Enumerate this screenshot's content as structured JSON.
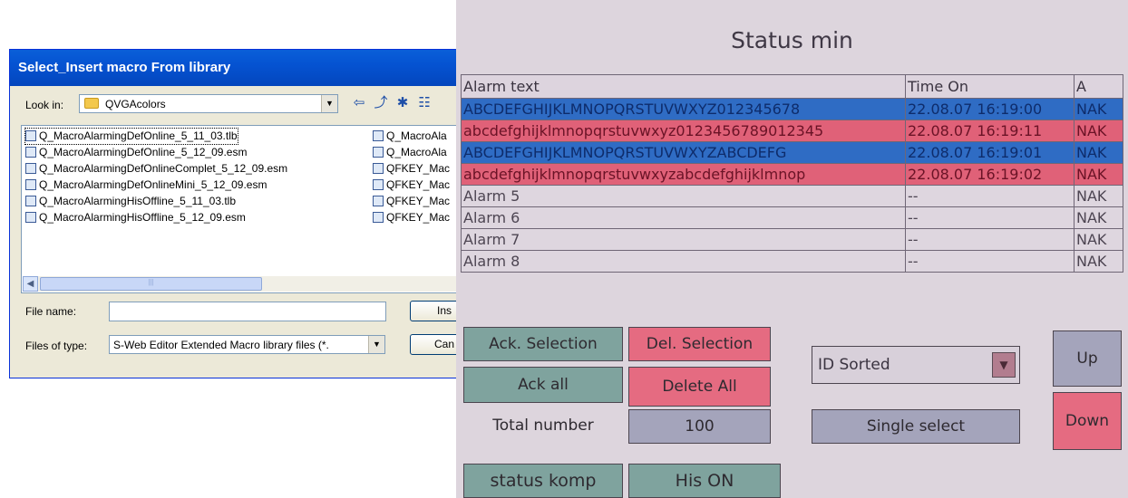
{
  "dialog": {
    "title": "Select_Insert macro From library",
    "look_in_label": "Look in:",
    "look_in_value": "QVGAcolors",
    "files_col1": [
      "Q_MacroAlarmingDefOnline_5_11_03.tlb",
      "Q_MacroAlarmingDefOnline_5_12_09.esm",
      "Q_MacroAlarmingDefOnlineComplet_5_12_09.esm",
      "Q_MacroAlarmingDefOnlineMini_5_12_09.esm",
      "Q_MacroAlarmingHisOffline_5_11_03.tlb",
      "Q_MacroAlarmingHisOffline_5_12_09.esm"
    ],
    "files_col2": [
      "Q_MacroAla",
      "Q_MacroAla",
      "QFKEY_Mac",
      "QFKEY_Mac",
      "QFKEY_Mac",
      "QFKEY_Mac"
    ],
    "file_name_label": "File name:",
    "file_name_value": "",
    "file_type_label": "Files of type:",
    "file_type_value": "S-Web Editor Extended Macro library files (*.",
    "insert_button": "Ins",
    "cancel_button": "Can"
  },
  "hmi": {
    "title": "Status min",
    "columns": [
      "Alarm text",
      "Time On",
      "A"
    ],
    "rows": [
      {
        "text": "ABCDEFGHIJKLMNOPQRSTUVWXYZ012345678",
        "time": "22.08.07  16:19:00",
        "ack": "NAK",
        "style": "blue"
      },
      {
        "text": "abcdefghijklmnopqrstuvwxyz0123456789012345",
        "time": "22.08.07  16:19:11",
        "ack": "NAK",
        "style": "red"
      },
      {
        "text": "ABCDEFGHIJKLMNOPQRSTUVWXYZABCDEFG",
        "time": "22.08.07  16:19:01",
        "ack": "NAK",
        "style": "blue"
      },
      {
        "text": "abcdefghijklmnopqrstuvwxyzabcdefghijklmnop",
        "time": "22.08.07  16:19:02",
        "ack": "NAK",
        "style": "red"
      },
      {
        "text": "Alarm 5",
        "time": "--",
        "ack": "NAK",
        "style": "plain"
      },
      {
        "text": "Alarm 6",
        "time": "--",
        "ack": "NAK",
        "style": "plain"
      },
      {
        "text": "Alarm 7",
        "time": "--",
        "ack": "NAK",
        "style": "plain"
      },
      {
        "text": "Alarm 8",
        "time": "--",
        "ack": "NAK",
        "style": "plain"
      }
    ],
    "buttons": {
      "ack_selection": "Ack. Selection",
      "del_selection": "Del. Selection",
      "ack_all": "Ack all",
      "delete_all": "Delete All",
      "total_number_label": "Total number",
      "total_number_value": "100",
      "id_sorted": "ID Sorted",
      "single_select": "Single select",
      "up": "Up",
      "down": "Down",
      "status_komp": "status komp",
      "his_on": "His ON"
    },
    "colors": {
      "blue_row": "#2f6cc4",
      "red_row": "#e06178",
      "teal_button": "#7fa39e",
      "pink_button": "#e56b81"
    }
  }
}
